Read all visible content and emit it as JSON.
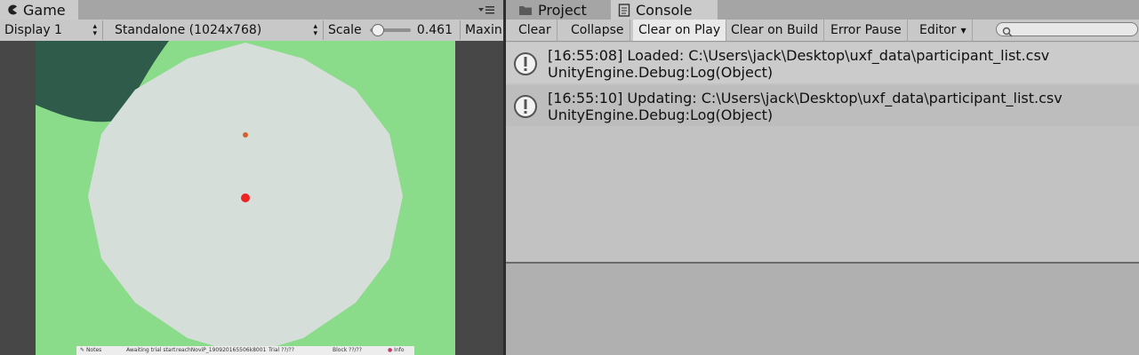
{
  "game": {
    "tab_label": "Game",
    "display_select": "Display 1",
    "resolution_select": "Standalone (1024x768)",
    "scale_label": "Scale",
    "scale_value": "0.461",
    "scale_fraction": 0.1,
    "maximize_label": "Maxin",
    "hud": {
      "notes": "Notes",
      "status": "Awaiting trial start",
      "session": "reachNoviP_190920165506k8001",
      "trial": "Trial ??/??",
      "block": "Block ??/??",
      "info": "Info"
    }
  },
  "console": {
    "tabs": [
      {
        "label": "Project",
        "icon": "folder-icon"
      },
      {
        "label": "Console",
        "icon": "console-icon"
      }
    ],
    "toolbar": {
      "clear": "Clear",
      "collapse": "Collapse",
      "clear_on_play": "Clear on Play",
      "clear_on_build": "Clear on Build",
      "error_pause": "Error Pause",
      "editor": "Editor"
    },
    "search_placeholder": "",
    "entries": [
      {
        "line1": "[16:55:08] Loaded: C:\\Users\\jack\\Desktop\\uxf_data\\participant_list.csv",
        "line2": "UnityEngine.Debug:Log(Object)"
      },
      {
        "line1": "[16:55:10] Updating: C:\\Users\\jack\\Desktop\\uxf_data\\participant_list.csv",
        "line2": "UnityEngine.Debug:Log(Object)"
      }
    ]
  },
  "colors": {
    "ground_green": "#8bdc8a",
    "dark_green": "#2e5b4a",
    "target_red": "#ee2222",
    "disc_grey": "#d6deda"
  }
}
